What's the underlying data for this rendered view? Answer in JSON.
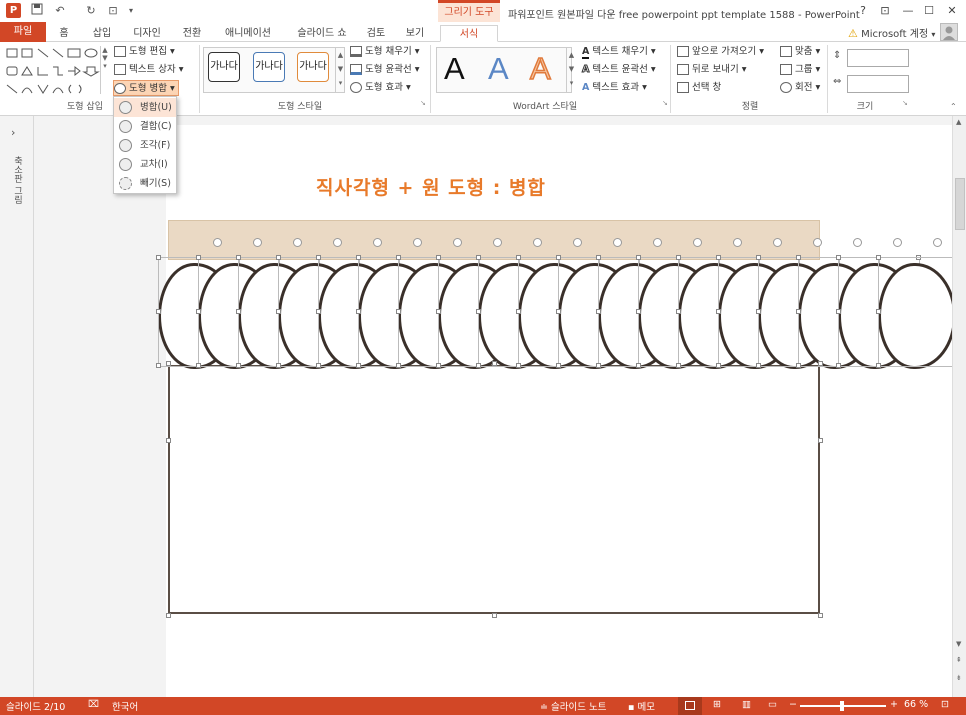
{
  "window": {
    "title": "파워포인트 원본파일 다운 free powerpoint ppt template 1588 - PowerPoint",
    "context_tab_header": "그리기 도구",
    "help": "?",
    "ribbon_opts": "⊡",
    "minimize": "—",
    "restore": "☐",
    "close": "✕"
  },
  "qat": {
    "save": "💾",
    "undo": "↶",
    "redo": "↻",
    "present": "⊡"
  },
  "tabs": [
    "파일",
    "홈",
    "삽입",
    "디자인",
    "전환",
    "애니메이션",
    "슬라이드 쇼",
    "검토",
    "보기",
    "서식"
  ],
  "account": {
    "label": "Microsoft 계정"
  },
  "ribbon": {
    "shape_insert": {
      "label": "도형 삽입",
      "edit_shape": "도형 편집",
      "text_box": "텍스트 상자",
      "merge_shapes": "도형 병합"
    },
    "shape_styles": {
      "label": "도형 스타일",
      "preview_text": "가나다",
      "fill": "도형 채우기",
      "outline": "도형 윤곽선",
      "effects": "도형 효과"
    },
    "wordart": {
      "label": "WordArt 스타일",
      "letter": "A",
      "text_fill": "텍스트 채우기",
      "text_outline": "텍스트 윤곽선",
      "text_effects": "텍스트 효과"
    },
    "arrange": {
      "label": "정렬",
      "bring_forward": "앞으로 가져오기",
      "send_backward": "뒤로 보내기",
      "selection_pane": "선택 창",
      "align": "맞춤",
      "group": "그룹",
      "rotate": "회전"
    },
    "size": {
      "label": "크기",
      "height": "",
      "width": ""
    }
  },
  "merge_menu": {
    "items": [
      "병합(U)",
      "결합(C)",
      "조각(F)",
      "교차(I)",
      "빼기(S)"
    ]
  },
  "left_panel": {
    "label": "축소판 그림"
  },
  "slide": {
    "title": "직사각형 + 원 도형 : 병합"
  },
  "status": {
    "slide_number": "슬라이드 2/10",
    "language": "한국어",
    "notes": "슬라이드 노트",
    "comments": "메모",
    "zoom": "66 %"
  },
  "colors": {
    "accent": "#d24726",
    "title_orange": "#e87a2a",
    "beige": "#ead9c4",
    "outline": "#3a302a"
  }
}
